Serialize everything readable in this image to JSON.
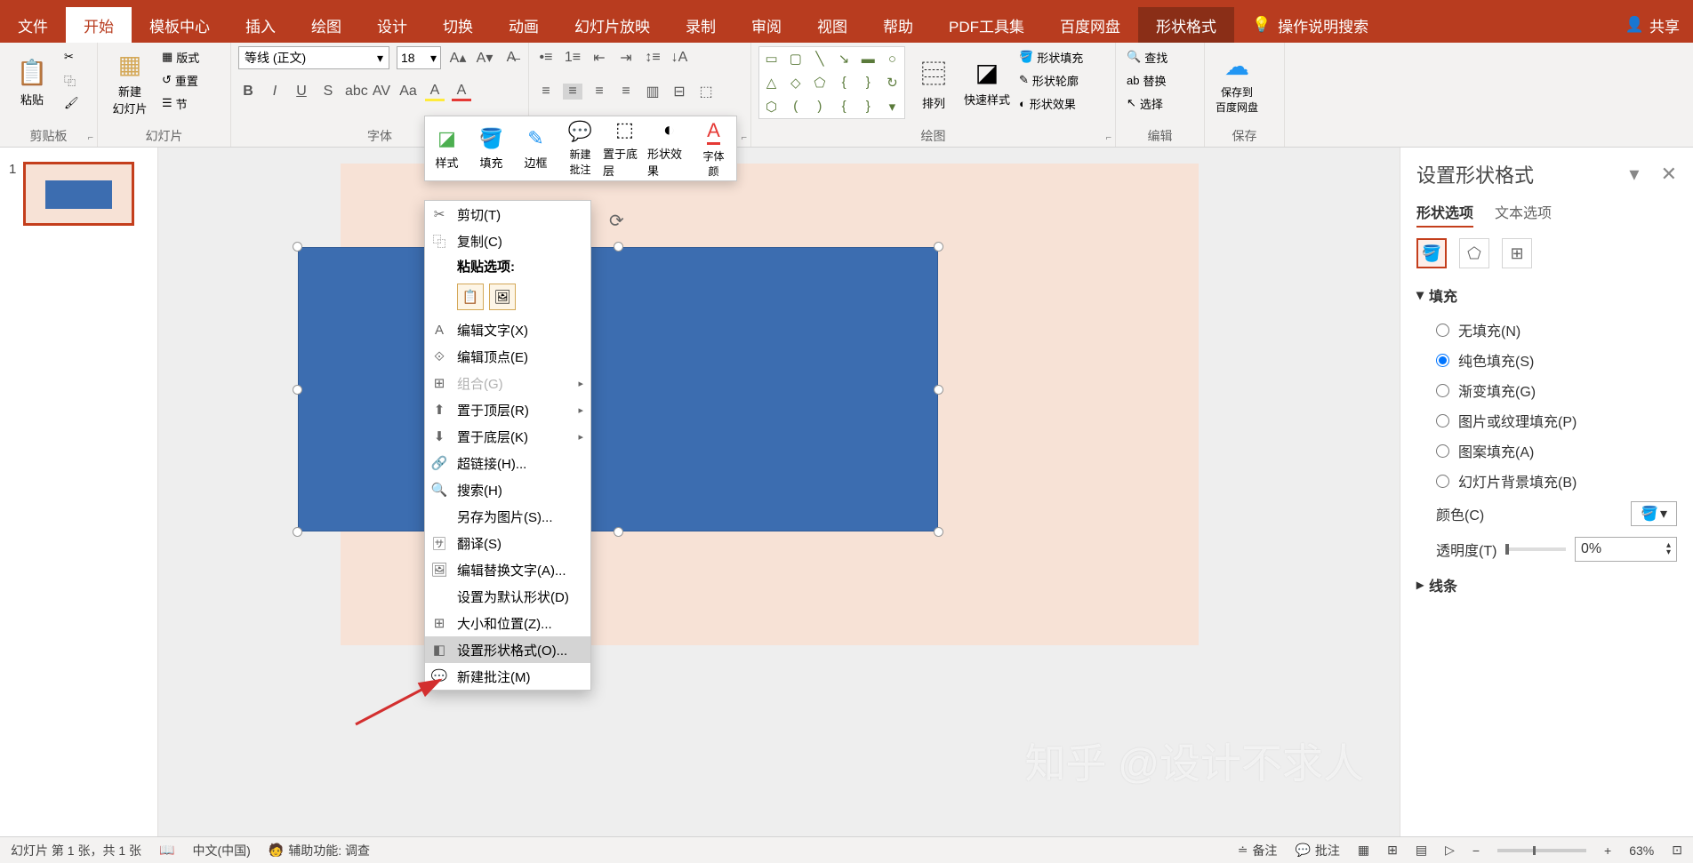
{
  "tabs": {
    "file": "文件",
    "home": "开始",
    "template": "模板中心",
    "insert": "插入",
    "draw": "绘图",
    "design": "设计",
    "transition": "切换",
    "animation": "动画",
    "slideshow": "幻灯片放映",
    "record": "录制",
    "review": "审阅",
    "view": "视图",
    "help": "帮助",
    "pdf": "PDF工具集",
    "baidu": "百度网盘",
    "format": "形状格式",
    "tellme": "操作说明搜索",
    "share": "共享"
  },
  "ribbon": {
    "clipboard": {
      "paste": "粘贴",
      "label": "剪贴板"
    },
    "slides": {
      "new": "新建\n幻灯片",
      "layout": "版式",
      "reset": "重置",
      "section": "节",
      "label": "幻灯片"
    },
    "font": {
      "name": "等线 (正文)",
      "size": "18",
      "label": "字体"
    },
    "drawing": {
      "arrange": "排列",
      "quick": "快速样式",
      "fill": "形状填充",
      "outline": "形状轮廓",
      "effects": "形状效果",
      "label": "绘图"
    },
    "editing": {
      "find": "查找",
      "replace": "替换",
      "select": "选择",
      "label": "编辑"
    },
    "save": {
      "btn": "保存到\n百度网盘",
      "label": "保存"
    }
  },
  "mini": {
    "style": "样式",
    "fill": "填充",
    "border": "边框",
    "comment": "新建\n批注",
    "back": "置于底层",
    "effect": "形状效果",
    "fontcolor": "字体\n颜"
  },
  "ctx": {
    "cut": "剪切(T)",
    "copy": "复制(C)",
    "paste_label": "粘贴选项:",
    "edittext": "编辑文字(X)",
    "editpoints": "编辑顶点(E)",
    "group": "组合(G)",
    "bringfront": "置于顶层(R)",
    "sendback": "置于底层(K)",
    "hyperlink": "超链接(H)...",
    "search": "搜索(H)",
    "saveas": "另存为图片(S)...",
    "translate": "翻译(S)",
    "alttext": "编辑替换文字(A)...",
    "default": "设置为默认形状(D)",
    "sizepos": "大小和位置(Z)...",
    "formatshape": "设置形状格式(O)...",
    "newcomment": "新建批注(M)"
  },
  "panel": {
    "title": "设置形状格式",
    "tab_shape": "形状选项",
    "tab_text": "文本选项",
    "fill": "填充",
    "nofill": "无填充(N)",
    "solid": "纯色填充(S)",
    "gradient": "渐变填充(G)",
    "picture": "图片或纹理填充(P)",
    "pattern": "图案填充(A)",
    "slidebg": "幻灯片背景填充(B)",
    "color": "颜色(C)",
    "transparency": "透明度(T)",
    "trans_val": "0%",
    "line": "线条"
  },
  "status": {
    "slide": "幻灯片 第 1 张，共 1 张",
    "lang": "中文(中国)",
    "access": "辅助功能: 调查",
    "notes": "备注",
    "comments": "批注",
    "zoom": "63%"
  },
  "thumb": {
    "num": "1"
  },
  "watermark": "知乎 @设计不求人"
}
